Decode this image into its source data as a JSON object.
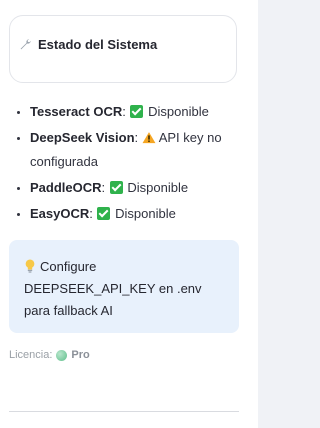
{
  "status_card": {
    "icon": "wrench-icon",
    "title": "Estado del Sistema"
  },
  "services": [
    {
      "name": "Tesseract OCR",
      "status_icon": "check-icon",
      "status": "Disponible"
    },
    {
      "name": "DeepSeek Vision",
      "status_icon": "warning-icon",
      "status": "API key no configurada"
    },
    {
      "name": "PaddleOCR",
      "status_icon": "check-icon",
      "status": "Disponible"
    },
    {
      "name": "EasyOCR",
      "status_icon": "check-icon",
      "status": "Disponible"
    }
  ],
  "info": {
    "icon": "lightbulb-icon",
    "message": "Configure DEEPSEEK_API_KEY en .env para fallback AI"
  },
  "license": {
    "label": "Licencia:",
    "value": "Pro",
    "icon": "license-status-dot"
  },
  "colors": {
    "check": "#2fb24c",
    "info_background": "#e8f1fc",
    "warning": "#f5a623"
  }
}
